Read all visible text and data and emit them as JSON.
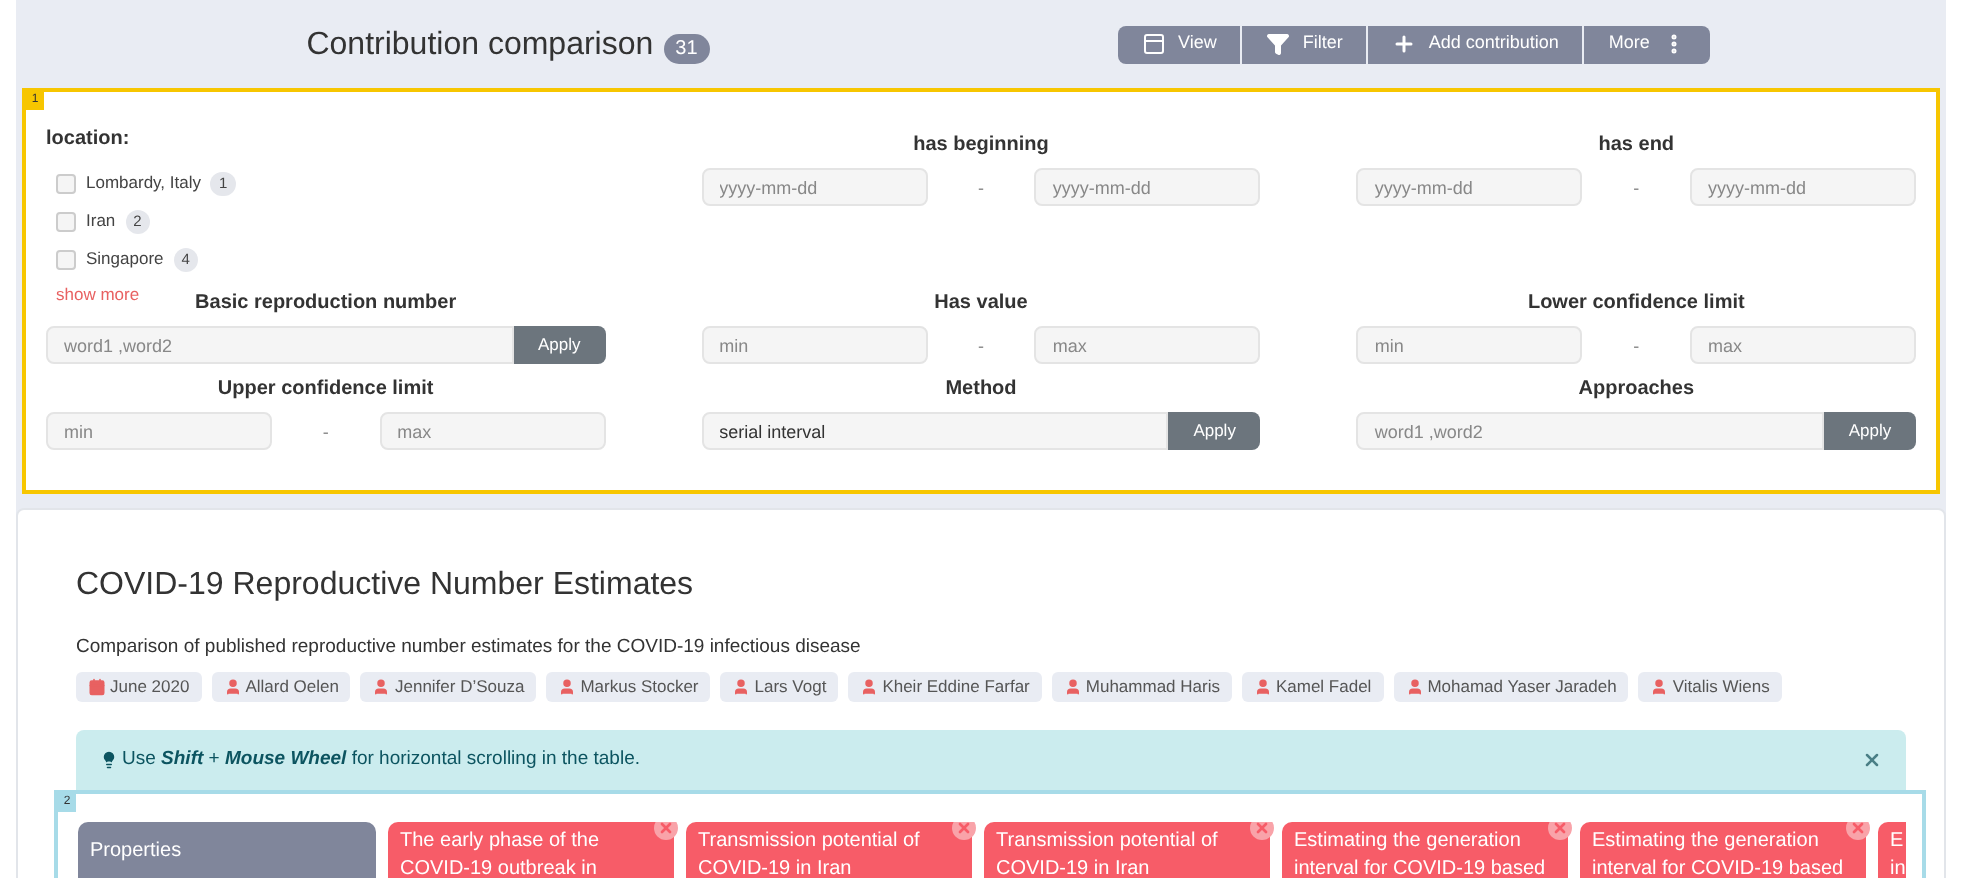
{
  "header": {
    "title": "Contribution comparison",
    "count": "31",
    "buttons": [
      {
        "label": "View"
      },
      {
        "label": "Filter"
      },
      {
        "label": "Add contribution"
      },
      {
        "label": "More"
      }
    ]
  },
  "filter_panel": {
    "marker": "1",
    "filters": [
      {
        "kind": "checklist",
        "label": "location:",
        "options": [
          {
            "label": "Lombardy, Italy",
            "count": "1",
            "checked": false
          },
          {
            "label": "Iran",
            "count": "2",
            "checked": false
          },
          {
            "label": "Singapore",
            "count": "4",
            "checked": false
          }
        ],
        "show_more": "show more"
      },
      {
        "kind": "range",
        "label": "has beginning",
        "min_placeholder": "yyyy-mm-dd",
        "separator": "-",
        "max_placeholder": "yyyy-mm-dd"
      },
      {
        "kind": "range",
        "label": "has end",
        "min_placeholder": "yyyy-mm-dd",
        "separator": "-",
        "max_placeholder": "yyyy-mm-dd"
      },
      {
        "kind": "text",
        "label": "Basic reproduction number",
        "placeholder": "word1 ,word2",
        "button": "Apply"
      },
      {
        "kind": "range",
        "label": "Has value",
        "min_placeholder": "min",
        "separator": "-",
        "max_placeholder": "max"
      },
      {
        "kind": "range",
        "label": "Lower confidence limit",
        "min_placeholder": "min",
        "separator": "-",
        "max_placeholder": "max"
      },
      {
        "kind": "range",
        "label": "Upper confidence limit",
        "min_placeholder": "min",
        "separator": "-",
        "max_placeholder": "max"
      },
      {
        "kind": "text",
        "label": "Method",
        "value": "serial interval",
        "button": "Apply"
      },
      {
        "kind": "text",
        "label": "Approaches",
        "placeholder": "word1 ,word2",
        "button": "Apply"
      }
    ]
  },
  "comparison": {
    "title": "COVID-19 Reproductive Number Estimates",
    "description": "Comparison of published reproductive number estimates for the COVID-19 infectious disease",
    "tags": [
      {
        "kind": "date",
        "label": "June 2020"
      },
      {
        "kind": "author",
        "label": "Allard Oelen"
      },
      {
        "kind": "author",
        "label": "Jennifer D’Souza"
      },
      {
        "kind": "author",
        "label": "Markus Stocker"
      },
      {
        "kind": "author",
        "label": "Lars Vogt"
      },
      {
        "kind": "author",
        "label": "Kheir Eddine Farfar"
      },
      {
        "kind": "author",
        "label": "Muhammad Haris"
      },
      {
        "kind": "author",
        "label": "Kamel Fadel"
      },
      {
        "kind": "author",
        "label": "Mohamad Yaser Jaradeh"
      },
      {
        "kind": "author",
        "label": "Vitalis Wiens"
      }
    ],
    "alert": "Use **Shift** + **Mouse Wheel** for horizontal scrolling in the table.",
    "table": {
      "marker": "2",
      "header": "Properties",
      "contributions": [
        {
          "lines": [
            "The early phase of the",
            "COVID-19 outbreak in"
          ],
          "removable": true
        },
        {
          "lines": [
            "Transmission potential of",
            "COVID-19 in Iran"
          ],
          "removable": true
        },
        {
          "lines": [
            "Transmission potential of",
            "COVID-19 in Iran"
          ],
          "removable": true
        },
        {
          "lines": [
            "Estimating the generation",
            "interval for COVID-19 based"
          ],
          "removable": true
        },
        {
          "lines": [
            "Estimating the generation",
            "interval for COVID-19 based"
          ],
          "removable": true
        },
        {
          "lines": [
            "E",
            "in"
          ]
        }
      ]
    }
  }
}
